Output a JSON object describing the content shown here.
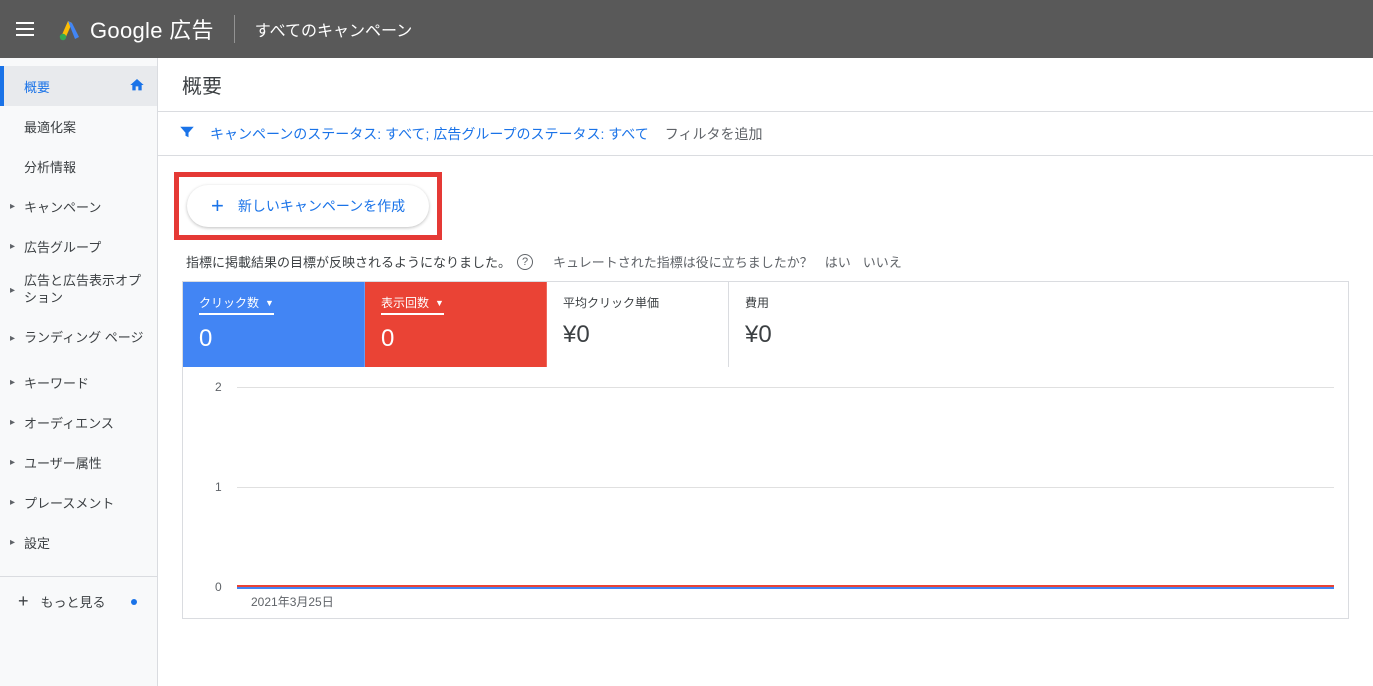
{
  "header": {
    "brand_google": "Google",
    "brand_ads": "広告",
    "breadcrumb": "すべてのキャンペーン"
  },
  "sidebar": {
    "items": [
      {
        "label": "概要",
        "active": true,
        "home": true
      },
      {
        "label": "最適化案"
      },
      {
        "label": "分析情報"
      },
      {
        "label": "キャンペーン",
        "caret": true
      },
      {
        "label": "広告グループ",
        "caret": true
      },
      {
        "label": "広告と広告表示オプション",
        "caret": true
      },
      {
        "label": "ランディング ページ",
        "caret": true
      },
      {
        "label": "キーワード",
        "caret": true
      },
      {
        "label": "オーディエンス",
        "caret": true
      },
      {
        "label": "ユーザー属性",
        "caret": true
      },
      {
        "label": "プレースメント",
        "caret": true
      },
      {
        "label": "設定",
        "caret": true
      }
    ],
    "more": "もっと見る"
  },
  "page": {
    "title": "概要"
  },
  "filter": {
    "text_blue": "キャンペーンのステータス: すべて; 広告グループのステータス: すべて",
    "add": "フィルタを追加"
  },
  "create": {
    "label": "新しいキャンペーンを作成"
  },
  "info": {
    "left": "指標に掲載結果の目標が反映されるようになりました。",
    "right_q": "キュレートされた指標は役に立ちましたか？",
    "yes": "はい",
    "no": "いいえ"
  },
  "metrics": [
    {
      "label": "クリック数",
      "value": "0",
      "color": "blue",
      "dropdown": true
    },
    {
      "label": "表示回数",
      "value": "0",
      "color": "red",
      "dropdown": true
    },
    {
      "label": "平均クリック単価",
      "value": "¥0",
      "color": "white"
    },
    {
      "label": "費用",
      "value": "¥0",
      "color": "white"
    }
  ],
  "chart_data": {
    "type": "line",
    "categories": [
      "2021年3月25日"
    ],
    "series": [
      {
        "name": "クリック数",
        "values": [
          0
        ],
        "color": "#4285f4"
      },
      {
        "name": "表示回数",
        "values": [
          0
        ],
        "color": "#ea4335"
      }
    ],
    "ylim": [
      0,
      2
    ],
    "yticks": [
      0,
      1,
      2
    ],
    "xlabel": "2021年3月25日"
  }
}
